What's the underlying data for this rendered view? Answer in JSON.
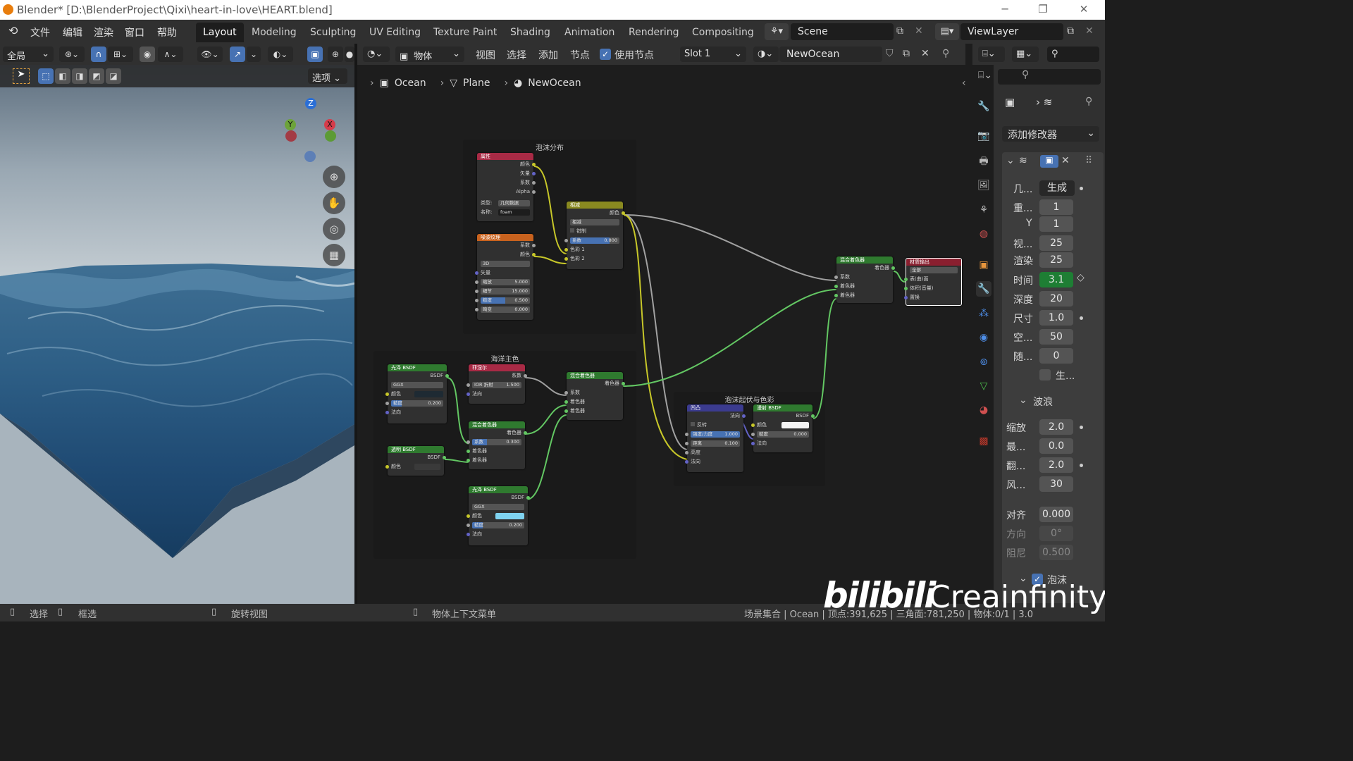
{
  "titlebar": {
    "title": "Blender* [D:\\BlenderProject\\Qixi\\heart-in-love\\HEART.blend]"
  },
  "menu": [
    "文件",
    "编辑",
    "渲染",
    "窗口",
    "帮助"
  ],
  "workspaces": [
    "Layout",
    "Modeling",
    "Sculpting",
    "UV Editing",
    "Texture Paint",
    "Shading",
    "Animation",
    "Rendering",
    "Compositing"
  ],
  "active_workspace": "Layout",
  "scene": "Scene",
  "viewlayer": "ViewLayer",
  "viewport_header": {
    "transform_orientation": "全局",
    "options": "选项"
  },
  "gizmo": {
    "z": "Z",
    "y": "Y",
    "x": "X"
  },
  "node_header": {
    "object_mode": "物体",
    "menu": [
      "视图",
      "选择",
      "添加",
      "节点"
    ],
    "use_nodes": "使用节点",
    "slot": "Slot 1",
    "material": "NewOcean"
  },
  "breadcrumb": [
    "Ocean",
    "Plane",
    "NewOcean"
  ],
  "frames": {
    "foam": "泡沫分布",
    "ocean": "海洋主色",
    "foam_bump": "泡沫起伏与色彩"
  },
  "nodes": {
    "attribute": {
      "title": "属性",
      "outputs": [
        "颜色",
        "矢量",
        "系数",
        "Alpha"
      ],
      "type_label": "类型:",
      "type_value": "几何数据",
      "name_label": "名称:",
      "name_value": "foam"
    },
    "noise": {
      "title": "噪波纹理",
      "outputs": [
        "系数",
        "颜色"
      ],
      "dim": "3D",
      "vector": "矢量",
      "scale_label": "缩放",
      "scale": "5.000",
      "detail_label": "细节",
      "detail": "15.000",
      "rough_label": "糙度",
      "rough": "0.500",
      "distort_label": "畸变",
      "distort": "0.000"
    },
    "subtract": {
      "title": "相减",
      "out": "颜色",
      "mode": "相减",
      "clamp": "钳制",
      "fac_label": "系数",
      "fac": "0.800",
      "c1": "色彩 1",
      "c2": "色彩 2"
    },
    "glossy1": {
      "title": "光泽 BSDF",
      "out": "BSDF",
      "dist": "GGX",
      "color": "颜色",
      "rough_label": "糙度",
      "rough": "0.200",
      "normal": "法向"
    },
    "fresnel": {
      "title": "菲涅尔",
      "out": "系数",
      "ior_label": "IOR 折射",
      "ior": "1.500",
      "normal": "法向"
    },
    "transparent": {
      "title": "透明 BSDF",
      "out": "BSDF",
      "color": "颜色"
    },
    "mix1": {
      "title": "混合着色器",
      "out": "着色器",
      "fac_label": "系数",
      "fac": "0.300",
      "s1": "着色器",
      "s2": "着色器"
    },
    "glossy2": {
      "title": "光泽 BSDF",
      "out": "BSDF",
      "dist": "GGX",
      "color": "颜色",
      "rough_label": "糙度",
      "rough": "0.200",
      "normal": "法向"
    },
    "mix2": {
      "title": "混合着色器",
      "out": "着色器",
      "fac": "系数",
      "s1": "着色器",
      "s2": "着色器"
    },
    "bump": {
      "title": "凹凸",
      "out": "法向",
      "invert": "反转",
      "strength_label": "强度/力度",
      "strength": "1.000",
      "dist_label": "距离",
      "dist": "0.100",
      "height": "高度",
      "normal": "法向"
    },
    "diffuse": {
      "title": "漫射 BSDF",
      "out": "BSDF",
      "color": "颜色",
      "rough_label": "糙度",
      "rough": "0.000",
      "normal": "法向"
    },
    "mix3": {
      "title": "混合着色器",
      "out": "着色器",
      "fac": "系数",
      "s1": "着色器",
      "s2": "着色器"
    },
    "output": {
      "title": "材质输出",
      "target": "全部",
      "surface": "表(曲)面",
      "volume": "体积(音量)",
      "disp": "置换"
    }
  },
  "properties": {
    "add_modifier": "添加修改器",
    "rows": [
      {
        "label": "几...",
        "value": "生成"
      },
      {
        "label": "重...",
        "value": "1"
      },
      {
        "label": "Y",
        "value": "1"
      },
      {
        "label": "视...",
        "value": "25"
      },
      {
        "label": "渲染",
        "value": "25"
      },
      {
        "label": "时间",
        "value": "3.1"
      },
      {
        "label": "深度",
        "value": "20"
      },
      {
        "label": "尺寸",
        "value": "1.0"
      },
      {
        "label": "空...",
        "value": "50"
      },
      {
        "label": "随...",
        "value": "0"
      }
    ],
    "gen_label": "生...",
    "waves_panel": "波浪",
    "waves": [
      {
        "label": "缩放",
        "value": "2.0"
      },
      {
        "label": "最...",
        "value": "0.0"
      },
      {
        "label": "翻...",
        "value": "2.0"
      },
      {
        "label": "风...",
        "value": "30"
      }
    ],
    "align_label": "对齐",
    "align": "0.000",
    "dir_label": "方向",
    "dir": "0°",
    "damp_label": "阻尼",
    "damp": "0.500",
    "foam_panel": "泡沫"
  },
  "status": {
    "select": "选择",
    "box": "框选",
    "rotate": "旋转视图",
    "context": "物体上下文菜单",
    "stats": "场景集合 | Ocean | 顶点:391,625 | 三角面:781,250 | 物体:0/1 | 3.0"
  },
  "watermark": "Creainfinity",
  "colors": {
    "accent": "#4772b3",
    "time_field": "#1e7e34",
    "frame_bg": "#1a1a1a",
    "shader_header": "#2f7a2f",
    "input_header": "#a82a45",
    "texture_header": "#c8621e",
    "color_header": "#8a8a20",
    "vector_header": "#3b3b8f",
    "output_header": "#8a1f2f"
  }
}
